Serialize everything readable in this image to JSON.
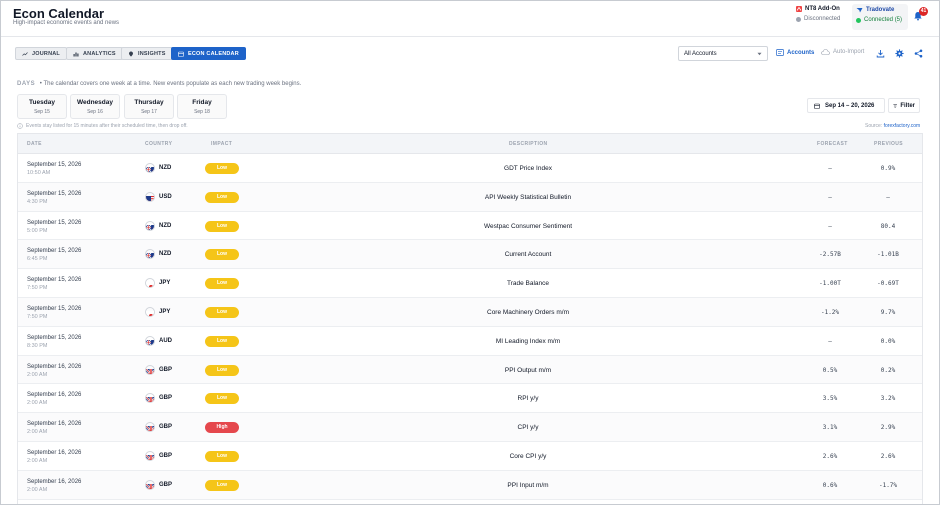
{
  "header": {
    "title": "Econ Calendar",
    "subtitle": "High-impact economic events and news",
    "nt8": {
      "title": "NT8 Add-On",
      "status": "Disconnected",
      "status_color": "#9ca3af"
    },
    "tradovate": {
      "title": "Tradovate",
      "status": "Connected (5)",
      "status_color": "#22c55e"
    },
    "notifications_count": "41"
  },
  "tabs": [
    {
      "label": "JOURNAL",
      "icon": "trend-icon"
    },
    {
      "label": "ANALYTICS",
      "icon": "bar-chart-icon"
    },
    {
      "label": "INSIGHTS",
      "icon": "pin-icon"
    },
    {
      "label": "ECON CALENDAR",
      "icon": "calendar-icon",
      "active": true
    }
  ],
  "toolbar": {
    "account_select": "All Accounts",
    "accounts_label": "Accounts",
    "auto_import_label": "Auto-Import"
  },
  "days": {
    "label": "DAYS",
    "hint": "The calendar covers one week at a time. New events populate as each new trading week begins.",
    "items": [
      {
        "name": "Tuesday",
        "date": "Sep 15"
      },
      {
        "name": "Wednesday",
        "date": "Sep 16"
      },
      {
        "name": "Thursday",
        "date": "Sep 17"
      },
      {
        "name": "Friday",
        "date": "Sep 18"
      }
    ],
    "range": "Sep 14 – 20, 2026",
    "filter_label": "Filter"
  },
  "note": "Events stay listed for 15 minutes after their scheduled time, then drop off.",
  "source_label": "Source:",
  "source_link": "forexfactory.com",
  "table": {
    "headers": {
      "date": "DATE",
      "country": "COUNTRY",
      "impact": "IMPACT",
      "description": "DESCRIPTION",
      "forecast": "FORECAST",
      "previous": "PREVIOUS"
    },
    "rows": [
      {
        "date": "September 15, 2026",
        "time": "10:50 AM",
        "ccy": "NZD",
        "impact": "Low",
        "desc": "GDT Price Index",
        "forecast": "–",
        "previous": "0.9%"
      },
      {
        "date": "September 15, 2026",
        "time": "4:30 PM",
        "ccy": "USD",
        "impact": "Low",
        "desc": "API Weekly Statistical Bulletin",
        "forecast": "–",
        "previous": "–"
      },
      {
        "date": "September 15, 2026",
        "time": "5:00 PM",
        "ccy": "NZD",
        "impact": "Low",
        "desc": "Westpac Consumer Sentiment",
        "forecast": "–",
        "previous": "80.4"
      },
      {
        "date": "September 15, 2026",
        "time": "6:45 PM",
        "ccy": "NZD",
        "impact": "Low",
        "desc": "Current Account",
        "forecast": "-2.57B",
        "previous": "-1.01B"
      },
      {
        "date": "September 15, 2026",
        "time": "7:50 PM",
        "ccy": "JPY",
        "impact": "Low",
        "desc": "Trade Balance",
        "forecast": "-1.00T",
        "previous": "-0.69T"
      },
      {
        "date": "September 15, 2026",
        "time": "7:50 PM",
        "ccy": "JPY",
        "impact": "Low",
        "desc": "Core Machinery Orders m/m",
        "forecast": "-1.2%",
        "previous": "9.7%"
      },
      {
        "date": "September 15, 2026",
        "time": "8:30 PM",
        "ccy": "AUD",
        "impact": "Low",
        "desc": "MI Leading Index m/m",
        "forecast": "–",
        "previous": "0.0%"
      },
      {
        "date": "September 16, 2026",
        "time": "2:00 AM",
        "ccy": "GBP",
        "impact": "Low",
        "desc": "PPI Output m/m",
        "forecast": "0.5%",
        "previous": "0.2%"
      },
      {
        "date": "September 16, 2026",
        "time": "2:00 AM",
        "ccy": "GBP",
        "impact": "Low",
        "desc": "RPI y/y",
        "forecast": "3.5%",
        "previous": "3.2%"
      },
      {
        "date": "September 16, 2026",
        "time": "2:00 AM",
        "ccy": "GBP",
        "impact": "High",
        "desc": "CPI y/y",
        "forecast": "3.1%",
        "previous": "2.9%"
      },
      {
        "date": "September 16, 2026",
        "time": "2:00 AM",
        "ccy": "GBP",
        "impact": "Low",
        "desc": "Core CPI y/y",
        "forecast": "2.6%",
        "previous": "2.6%"
      },
      {
        "date": "September 16, 2026",
        "time": "2:00 AM",
        "ccy": "GBP",
        "impact": "Low",
        "desc": "PPI Input m/m",
        "forecast": "0.6%",
        "previous": "-1.7%"
      }
    ]
  }
}
